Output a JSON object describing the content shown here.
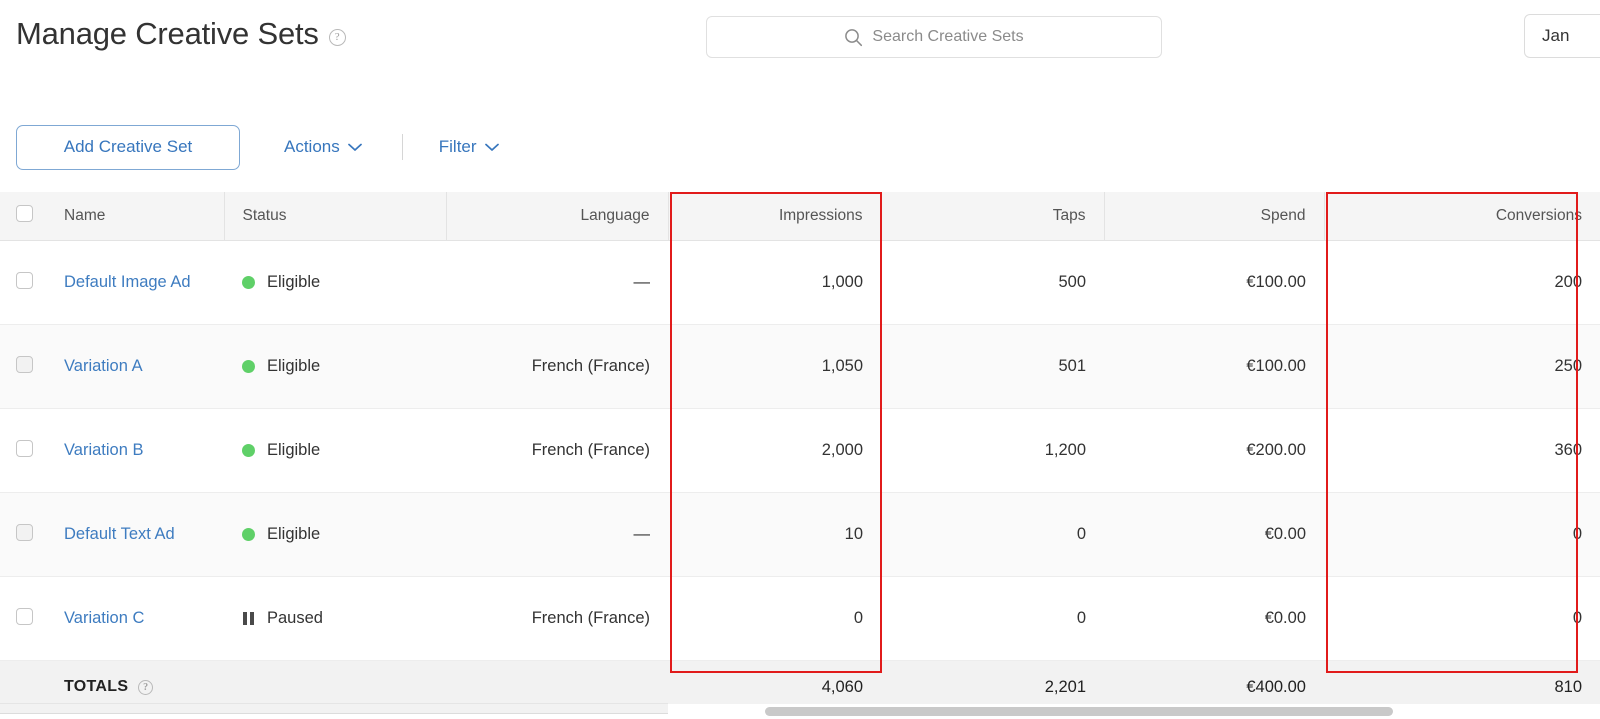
{
  "header": {
    "title": "Manage Creative Sets",
    "help_icon": "question-circle-icon",
    "search": {
      "icon": "search-icon",
      "placeholder": "Search Creative Sets"
    },
    "date_range_value": "Jan"
  },
  "toolbar": {
    "add_label": "Add Creative Set",
    "actions_label": "Actions",
    "filter_label": "Filter",
    "chevron": "⌄"
  },
  "table": {
    "columns": [
      {
        "key": "check",
        "label": "",
        "align": "left"
      },
      {
        "key": "name",
        "label": "Name",
        "align": "left"
      },
      {
        "key": "status",
        "label": "Status",
        "align": "left"
      },
      {
        "key": "lang",
        "label": "Language",
        "align": "right"
      },
      {
        "key": "impr",
        "label": "Impressions",
        "align": "right"
      },
      {
        "key": "taps",
        "label": "Taps",
        "align": "right"
      },
      {
        "key": "spend",
        "label": "Spend",
        "align": "right"
      },
      {
        "key": "conv",
        "label": "Conversions",
        "align": "right"
      }
    ],
    "rows": [
      {
        "name": "Default Image Ad",
        "status": "Eligible",
        "status_type": "eligible",
        "language": "—",
        "impressions": "1,000",
        "taps": "500",
        "spend": "€100.00",
        "conversions": "200"
      },
      {
        "name": "Variation A",
        "status": "Eligible",
        "status_type": "eligible",
        "language": "French (France)",
        "impressions": "1,050",
        "taps": "501",
        "spend": "€100.00",
        "conversions": "250"
      },
      {
        "name": "Variation B",
        "status": "Eligible",
        "status_type": "eligible",
        "language": "French (France)",
        "impressions": "2,000",
        "taps": "1,200",
        "spend": "€200.00",
        "conversions": "360"
      },
      {
        "name": "Default Text Ad",
        "status": "Eligible",
        "status_type": "eligible",
        "language": "—",
        "impressions": "10",
        "taps": "0",
        "spend": "€0.00",
        "conversions": "0"
      },
      {
        "name": "Variation C",
        "status": "Paused",
        "status_type": "paused",
        "language": "French (France)",
        "impressions": "0",
        "taps": "0",
        "spend": "€0.00",
        "conversions": "0"
      }
    ],
    "totals": {
      "label": "TOTALS",
      "help_icon": "question-circle-icon",
      "impressions": "4,060",
      "taps": "2,201",
      "spend": "€400.00",
      "conversions": "810"
    }
  },
  "highlights": [
    {
      "name": "impressions-column-highlight",
      "color": "#e11b1b"
    },
    {
      "name": "conversions-column-highlight",
      "color": "#e11b1b"
    }
  ],
  "colors": {
    "link_blue": "#3e7cc0",
    "status_green": "#5fd068",
    "status_paused_gray": "#4a4a4a",
    "highlight_red": "#e11b1b",
    "header_gray": "#f5f5f5",
    "totals_gray": "#f2f2f2"
  }
}
